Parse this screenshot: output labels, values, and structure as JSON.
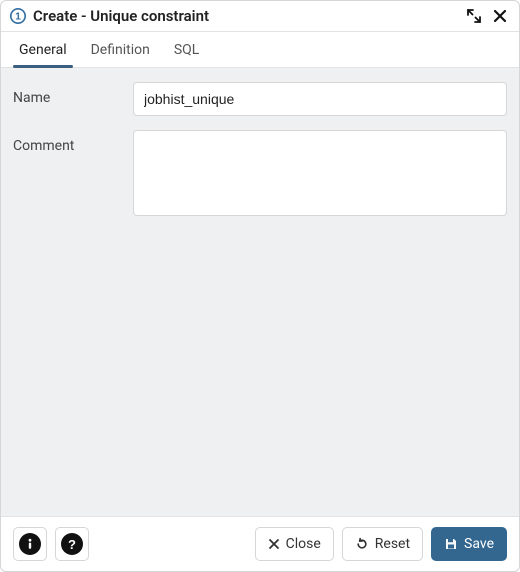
{
  "header": {
    "title": "Create - Unique constraint"
  },
  "tabs": {
    "items": [
      {
        "label": "General",
        "active": true
      },
      {
        "label": "Definition",
        "active": false
      },
      {
        "label": "SQL",
        "active": false
      }
    ]
  },
  "form": {
    "name_label": "Name",
    "name_value": "jobhist_unique",
    "comment_label": "Comment",
    "comment_value": ""
  },
  "footer": {
    "close_label": "Close",
    "reset_label": "Reset",
    "save_label": "Save"
  }
}
